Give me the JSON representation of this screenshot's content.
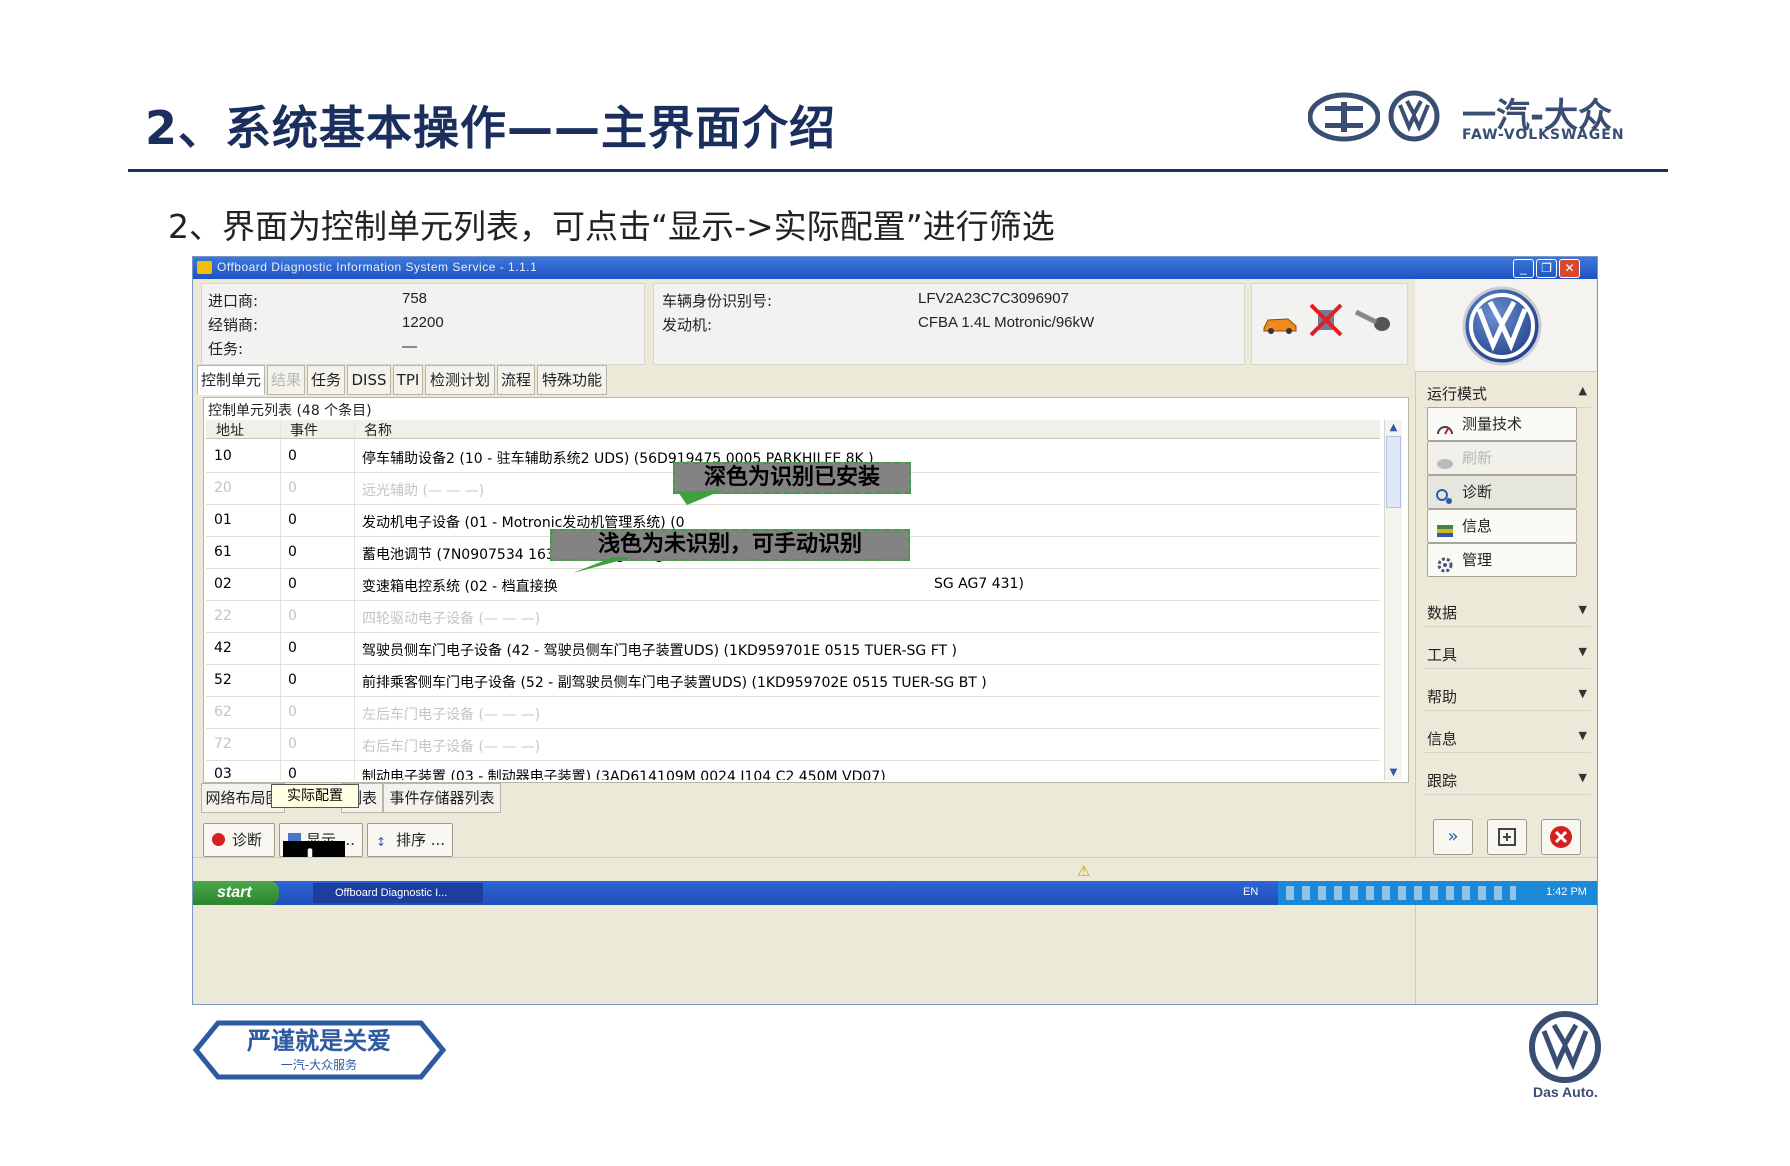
{
  "slide": {
    "title": "2、系统基本操作——主界面介绍",
    "subtitle": "2、界面为控制单元列表，可点击“显示->实际配置”进行筛选",
    "brand_cn": "一汽-大众",
    "brand_en": "FAW-VOLKSWAGEN",
    "footer_slogan_cn": "严谨就是关爱",
    "footer_slogan_sub": "一汽-大众服务",
    "footer_das_auto": "Das Auto."
  },
  "window": {
    "title": "Offboard Diagnostic Information System Service - 1.1.1",
    "controls": {
      "minimize": "_",
      "restore": "❐",
      "close": "✕"
    }
  },
  "info": {
    "importer_label": "进口商:",
    "importer_value": "758",
    "dealer_label": "经销商:",
    "dealer_value": "12200",
    "task_label": "任务:",
    "task_value": "—",
    "vin_label": "车辆身份识别号:",
    "vin_value": "LFV2A23C7C3096907",
    "engine_label": "发动机:",
    "engine_value": "CFBA 1.4L Motronic/96kW"
  },
  "tabs": [
    {
      "label": "控制单元",
      "state": "active"
    },
    {
      "label": "结果",
      "state": "disabled"
    },
    {
      "label": "任务",
      "state": "normal"
    },
    {
      "label": "DISS",
      "state": "normal"
    },
    {
      "label": "TPI",
      "state": "normal"
    },
    {
      "label": "检测计划",
      "state": "normal"
    },
    {
      "label": "流程",
      "state": "normal"
    },
    {
      "label": "特殊功能",
      "state": "normal"
    }
  ],
  "list": {
    "caption": "控制单元列表 (48 个条目)",
    "columns": [
      "地址",
      "事件",
      "名称"
    ],
    "rows": [
      {
        "address": "10",
        "events": "0",
        "name": "停车辅助设备2 (10 - 驻车辅助系统2 UDS) (56D919475    0005   PARKHILFE 8K )",
        "faded": false
      },
      {
        "address": "20",
        "events": "0",
        "name": "远光辅助 (—   —   —)",
        "faded": true
      },
      {
        "address": "01",
        "events": "0",
        "name": "发动机电子设备 (01 - Motronic发动机管理系统) (0",
        "faded": false
      },
      {
        "address": "61",
        "events": "0",
        "name": "蓄电池调节 (7N0907534     1632   Batt.regelung)",
        "faded": false
      },
      {
        "address": "02",
        "events": "0",
        "name": "变速箱电控系统 (02 - 档直接换",
        "name_tail": "SG AG7     431)",
        "faded": false
      },
      {
        "address": "22",
        "events": "0",
        "name": "四轮驱动电子设备 (—   —   —)",
        "faded": true
      },
      {
        "address": "42",
        "events": "0",
        "name": "驾驶员侧车门电子设备 (42 - 驾驶员侧车门电子装置UDS) (1KD959701E    0515   TUER-SG FT   )",
        "faded": false
      },
      {
        "address": "52",
        "events": "0",
        "name": "前排乘客侧车门电子设备 (52 - 副驾驶员侧车门电子装置UDS) (1KD959702E    0515   TUER-SG BT   )",
        "faded": false
      },
      {
        "address": "62",
        "events": "0",
        "name": "左后车门电子设备 (—   —   —)",
        "faded": true
      },
      {
        "address": "72",
        "events": "0",
        "name": "右后车门电子设备 (—   —   —)",
        "faded": true
      },
      {
        "address": "03",
        "events": "0",
        "name": "制动电子装置 (03 - 制动器电子装置) (3AD614109M     0024   J104    C2 450M VD07)",
        "faded": false
      }
    ]
  },
  "bottom_tabs": [
    {
      "label": "网络布局图"
    },
    {
      "label": "列表"
    },
    {
      "label": "事件存储器列表"
    }
  ],
  "tooltip": "实际配置",
  "actions": {
    "diagnose": "诊断",
    "display": "显示 ...",
    "sort": "排序 ..."
  },
  "sidebar": {
    "mode_header": "运行模式",
    "buttons": [
      {
        "label": "测量技术",
        "disabled": false
      },
      {
        "label": "刷新",
        "disabled": true
      },
      {
        "label": "诊断",
        "disabled": false
      },
      {
        "label": "信息",
        "disabled": false
      },
      {
        "label": "管理",
        "disabled": false
      }
    ],
    "sections": [
      "数据",
      "工具",
      "帮助",
      "信息",
      "跟踪"
    ]
  },
  "callouts": {
    "installed": "深色为识别已安装",
    "not_identified": "浅色为未识别，可手动识别"
  },
  "taskbar": {
    "start": "start",
    "task": "Offboard Diagnostic I...",
    "lang": "EN",
    "time": "1:42 PM"
  },
  "colors": {
    "title_navy": "#1b2f5e",
    "callout_fill": "#838383",
    "callout_border": "#3fa03f",
    "xp_blue": "#1f52c4"
  }
}
